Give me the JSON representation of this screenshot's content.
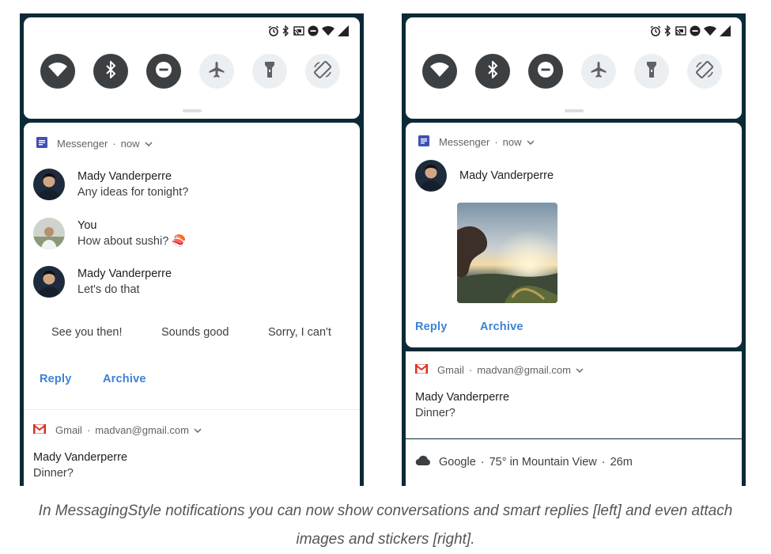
{
  "left": {
    "quick_settings": {
      "tiles": [
        {
          "icon": "wifi-icon",
          "state": "on"
        },
        {
          "icon": "bluetooth-icon",
          "state": "on"
        },
        {
          "icon": "do-not-disturb-icon",
          "state": "on"
        },
        {
          "icon": "airplane-icon",
          "state": "off"
        },
        {
          "icon": "flashlight-icon",
          "state": "off"
        },
        {
          "icon": "auto-rotate-icon",
          "state": "off"
        }
      ]
    },
    "messenger": {
      "app": "Messenger",
      "sep": "·",
      "time": "now",
      "messages": [
        {
          "sender": "Mady Vanderperre",
          "text": "Any ideas for tonight?"
        },
        {
          "sender": "You",
          "text": "How about sushi? 🍣"
        },
        {
          "sender": "Mady Vanderperre",
          "text": "Let's do that"
        }
      ],
      "smart_replies": [
        "See you then!",
        "Sounds good",
        "Sorry, I can't"
      ],
      "actions": {
        "reply": "Reply",
        "archive": "Archive"
      }
    },
    "gmail": {
      "app": "Gmail",
      "sep": "·",
      "account": "madvan@gmail.com",
      "sender": "Mady Vanderperre",
      "subject": "Dinner?"
    }
  },
  "right": {
    "messenger": {
      "app": "Messenger",
      "sep": "·",
      "time": "now",
      "sender": "Mady Vanderperre",
      "actions": {
        "reply": "Reply",
        "archive": "Archive"
      }
    },
    "gmail": {
      "app": "Gmail",
      "sep": "·",
      "account": "madvan@gmail.com",
      "sender": "Mady Vanderperre",
      "subject": "Dinner?"
    },
    "weather": {
      "app": "Google",
      "sep1": "·",
      "text": "75° in Mountain View",
      "sep2": "·",
      "time": "26m"
    }
  },
  "caption": {
    "line1": "In MessagingStyle notifications you can now show conversations and smart replies [left] and even attach",
    "line2": "images and stickers [right]."
  },
  "colors": {
    "accent": "#3b82d6",
    "messenger_icon": "#3f51b5",
    "gmail_red": "#d93025",
    "tile_on": "#3d4043",
    "tile_off": "#eceff1"
  }
}
